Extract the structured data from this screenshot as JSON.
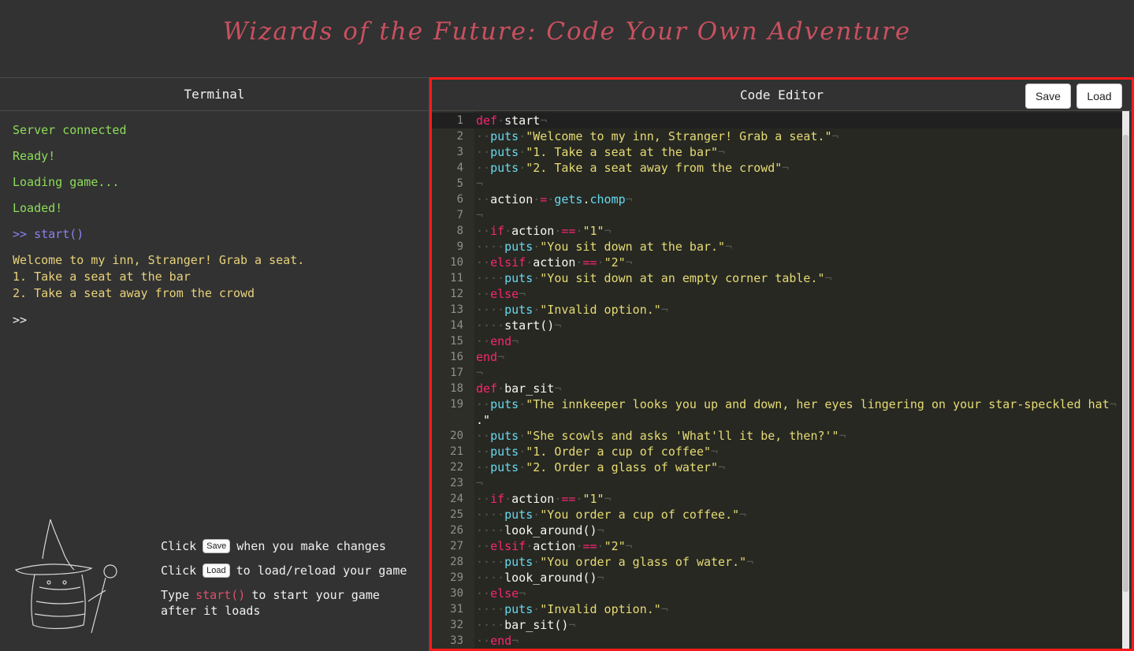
{
  "app": {
    "title": "Wizards of the Future: Code Your Own Adventure"
  },
  "terminal": {
    "title": "Terminal",
    "lines": [
      "Server connected",
      "Ready!",
      "Loading game...",
      "Loaded!"
    ],
    "command": ">> start()",
    "output": [
      "Welcome to my inn, Stranger! Grab a seat.",
      "1. Take a seat at the bar",
      "2. Take a seat away from the crowd"
    ],
    "prompt": ">>"
  },
  "help": {
    "click": "Click",
    "save_key": "Save",
    "save_text": "when you make changes",
    "load_key": "Load",
    "load_text": "to load/reload your game",
    "type": "Type",
    "start_word": "start()",
    "start_text": "to start your game",
    "after_text": "after it loads"
  },
  "editor": {
    "title": "Code Editor",
    "save_label": "Save",
    "load_label": "Load",
    "active_line": 1,
    "lines": [
      "def start",
      "  puts \"Welcome to my inn, Stranger! Grab a seat.\"",
      "  puts \"1. Take a seat at the bar\"",
      "  puts \"2. Take a seat away from the crowd\"",
      "",
      "  action = gets.chomp",
      "",
      "  if action == \"1\"",
      "    puts \"You sit down at the bar.\"",
      "  elsif action == \"2\"",
      "    puts \"You sit down at an empty corner table.\"",
      "  else",
      "    puts \"Invalid option.\"",
      "    start()",
      "  end",
      "end",
      "",
      "def bar_sit",
      "  puts \"The innkeeper looks you up and down, her eyes lingering on your star-speckled hat\n.\"",
      "  puts \"She scowls and asks 'What'll it be, then?'\"",
      "  puts \"1. Order a cup of coffee\"",
      "  puts \"2. Order a glass of water\"",
      "",
      "  if action == \"1\"",
      "    puts \"You order a cup of coffee.\"",
      "    look_around()",
      "  elsif action == \"2\"",
      "    puts \"You order a glass of water.\"",
      "    look_around()",
      "  else",
      "    puts \"Invalid option.\"",
      "    bar_sit()",
      "  end"
    ]
  },
  "colors": {
    "title": "#c9505f",
    "terminal_green": "#8ddc5b",
    "terminal_cmd": "#8a82f0",
    "terminal_output": "#e8d27a",
    "highlight_border": "#ff1a1a",
    "keyword": "#f92672",
    "builtin": "#66d9ef",
    "string": "#e6db74"
  }
}
